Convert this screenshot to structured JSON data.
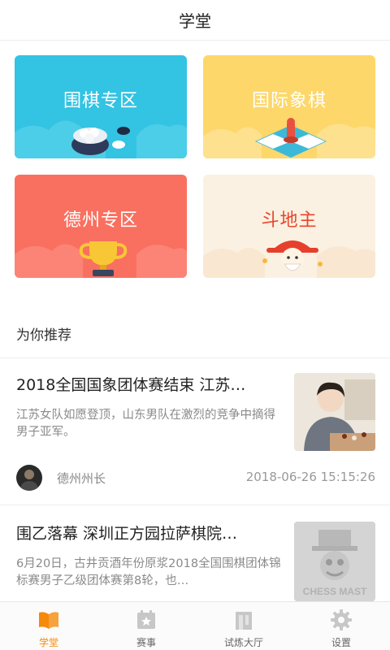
{
  "header": {
    "title": "学堂"
  },
  "cards": [
    {
      "label": "围棋专区",
      "color": "#33c3e3"
    },
    {
      "label": "国际象棋",
      "color": "#fdd76a"
    },
    {
      "label": "德州专区",
      "color": "#f97060"
    },
    {
      "label": "斗地主",
      "color": "#fbf1e2"
    }
  ],
  "section": {
    "title": "为你推荐"
  },
  "articles": [
    {
      "title": "2018全国国象团体赛结束 江苏…",
      "summary": "江苏女队如愿登顶，山东男队在激烈的竞争中摘得男子亚军。",
      "author": "德州州长",
      "time": "2018-06-26 15:15:26"
    },
    {
      "title": "围乙落幕 深圳正方园拉萨棋院…",
      "summary": "6月20日，古井贡酒年份原浆2018全国围棋团体锦标赛男子乙级团体赛第8轮，也…",
      "thumb_text": "CHESS MAST"
    }
  ],
  "tabbar": {
    "items": [
      {
        "label": "学堂",
        "icon": "book-icon",
        "active": true
      },
      {
        "label": "赛事",
        "icon": "calendar-star-icon",
        "active": false
      },
      {
        "label": "试炼大厅",
        "icon": "hall-icon",
        "active": false
      },
      {
        "label": "设置",
        "icon": "gear-icon",
        "active": false
      }
    ],
    "active_color": "#f58a0b"
  }
}
